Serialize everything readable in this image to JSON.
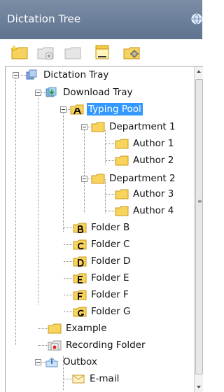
{
  "window": {
    "title": "Dictation Tree",
    "title_icon": "globe-icon"
  },
  "toolbar": {
    "buttons": [
      {
        "icon": "new-folder-icon"
      },
      {
        "icon": "add-item-icon"
      },
      {
        "icon": "remove-item-icon"
      },
      {
        "icon": "properties-icon"
      },
      {
        "icon": "settings-icon"
      }
    ]
  },
  "tree": {
    "nodes": [
      {
        "label": "Dictation Tray",
        "icon": "dictation-tray-icon",
        "level": 0,
        "expanded": true
      },
      {
        "label": "Download Tray",
        "icon": "download-tray-icon",
        "level": 1,
        "expanded": true
      },
      {
        "label": "Typing Pool",
        "icon": "folder-a-icon",
        "level": 2,
        "expanded": true,
        "selected": true
      },
      {
        "label": "Department 1",
        "icon": "folder-icon",
        "level": 3,
        "expanded": true
      },
      {
        "label": "Author 1",
        "icon": "folder-icon",
        "level": 4
      },
      {
        "label": "Author 2",
        "icon": "folder-icon",
        "level": 4
      },
      {
        "label": "Department 2",
        "icon": "folder-icon",
        "level": 3,
        "expanded": true
      },
      {
        "label": "Author 3",
        "icon": "folder-icon",
        "level": 4
      },
      {
        "label": "Author 4",
        "icon": "folder-icon",
        "level": 4
      },
      {
        "label": "Folder B",
        "icon": "folder-b-icon",
        "level": 2
      },
      {
        "label": "Folder C",
        "icon": "folder-c-icon",
        "level": 2
      },
      {
        "label": "Folder D",
        "icon": "folder-d-icon",
        "level": 2
      },
      {
        "label": "Folder E",
        "icon": "folder-e-icon",
        "level": 2
      },
      {
        "label": "Folder F",
        "icon": "folder-f-icon",
        "level": 2
      },
      {
        "label": "Folder G",
        "icon": "folder-g-icon",
        "level": 2
      },
      {
        "label": "Example",
        "icon": "folder-icon",
        "level": 1
      },
      {
        "label": "Recording Folder",
        "icon": "recording-folder-icon",
        "level": 1
      },
      {
        "label": "Outbox",
        "icon": "outbox-icon",
        "level": 1,
        "expanded": true
      },
      {
        "label": "E-mail",
        "icon": "email-icon",
        "level": 2
      }
    ]
  },
  "colors": {
    "titlebar": "#6d809b",
    "selection": "#3399ff",
    "folder_fill": "#f8d45c",
    "folder_stroke": "#c99a1f"
  }
}
